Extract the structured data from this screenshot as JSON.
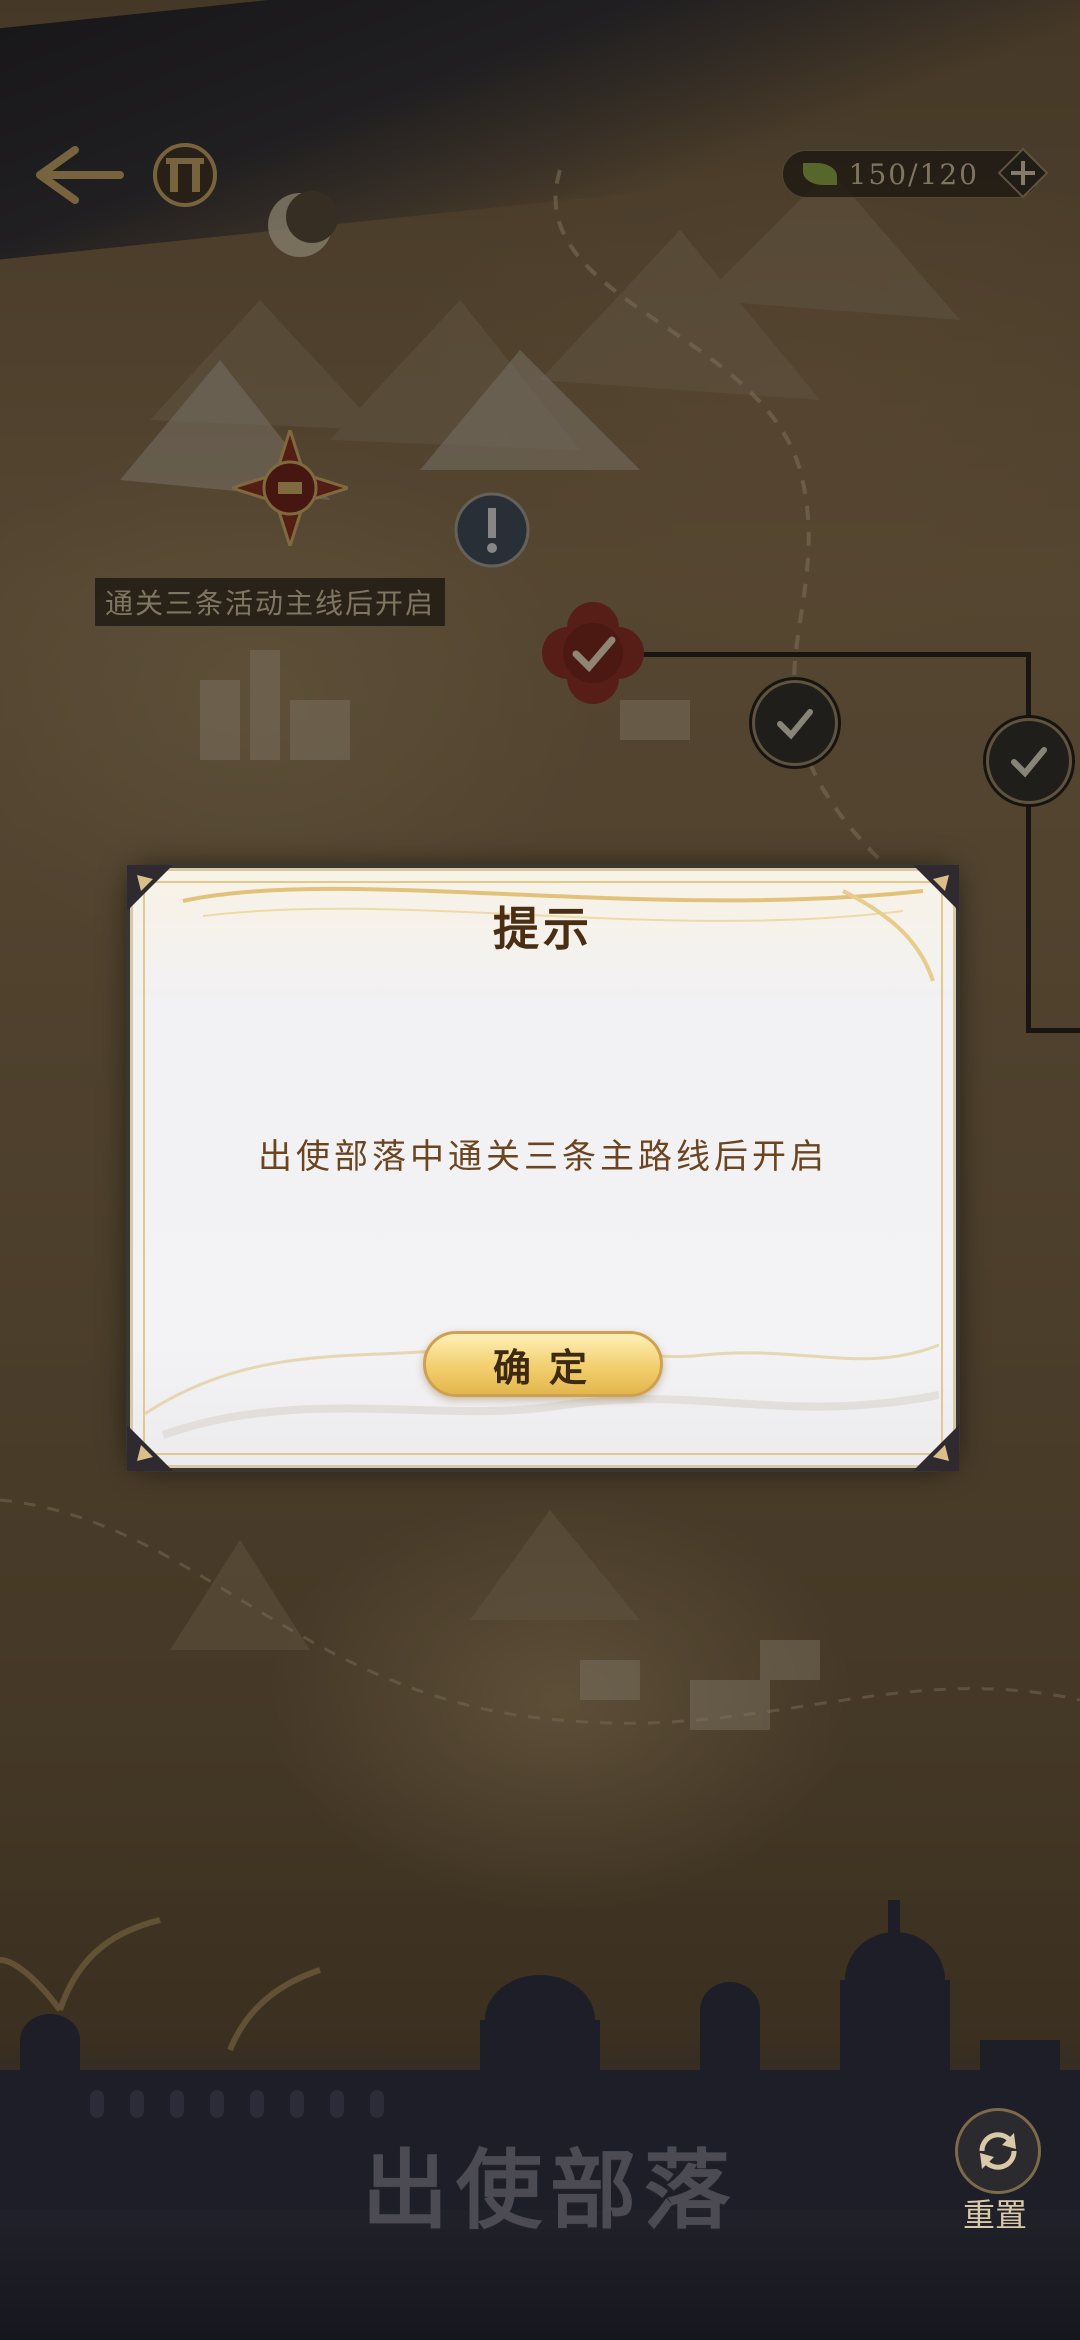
{
  "map": {
    "notice": "通关三条活动主线后开启",
    "resource": {
      "current": "150",
      "max": "120"
    }
  },
  "footer": {
    "title": "出使部落",
    "reset_label": "重置"
  },
  "dialog": {
    "title": "提示",
    "message": "出使部落中通关三条主路线后开启",
    "confirm_label": "确定"
  }
}
